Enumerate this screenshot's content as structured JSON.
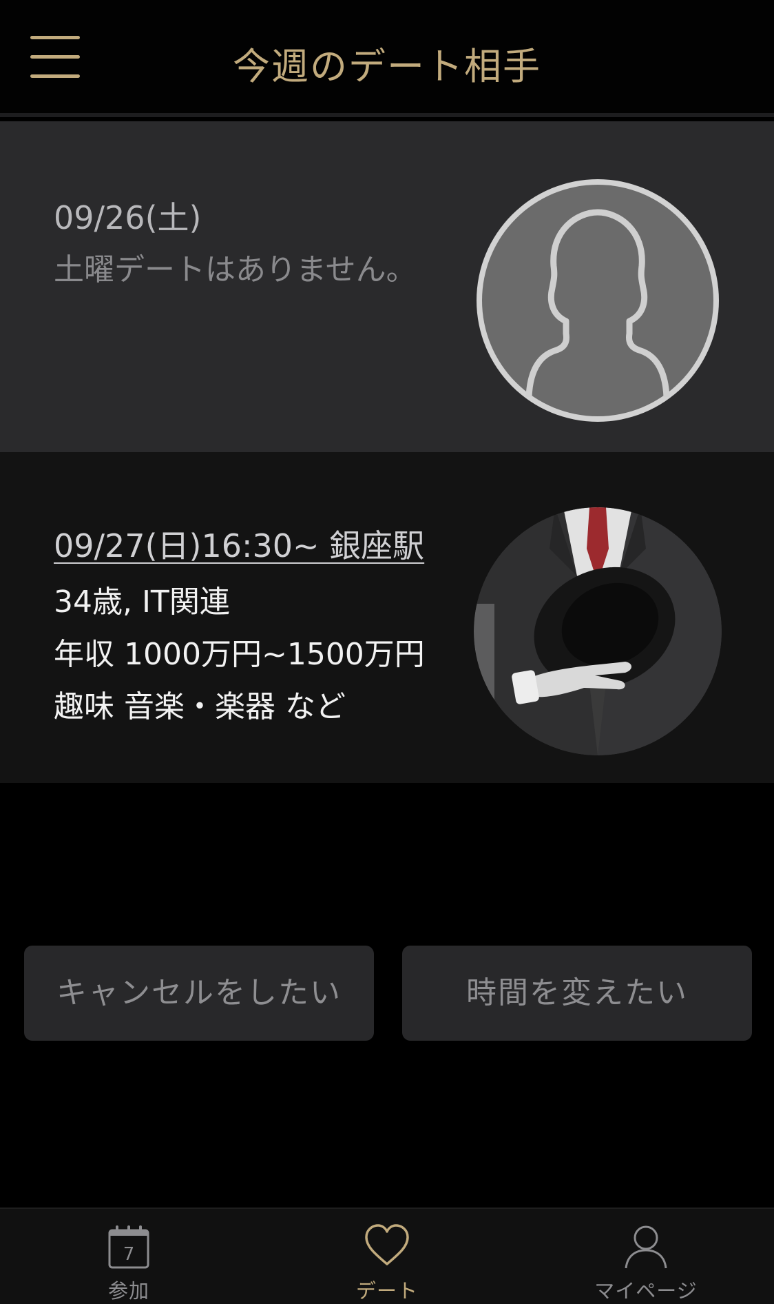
{
  "header": {
    "title": "今週のデート相手",
    "menu_icon": "hamburger-menu-icon",
    "accent_color": "#c2ab7d"
  },
  "dates": [
    {
      "date": "09/26(土)",
      "note": "土曜デートはありません。",
      "avatar": "placeholder-person-icon"
    },
    {
      "date_time_place": "09/27(日)16:30~ 銀座駅",
      "age_industry": "34歳, IT関連",
      "income": "年収 1000万円~1500万円",
      "hobby": "趣味 音楽・楽器 など",
      "avatar": "partner-photo"
    }
  ],
  "actions": {
    "cancel_label": "キャンセルをしたい",
    "reschedule_label": "時間を変えたい"
  },
  "tabbar": {
    "items": [
      {
        "label": "参加",
        "icon": "calendar-icon",
        "icon_number": "7",
        "active": false
      },
      {
        "label": "デート",
        "icon": "heart-icon",
        "active": true
      },
      {
        "label": "マイページ",
        "icon": "person-icon",
        "active": false
      }
    ]
  }
}
